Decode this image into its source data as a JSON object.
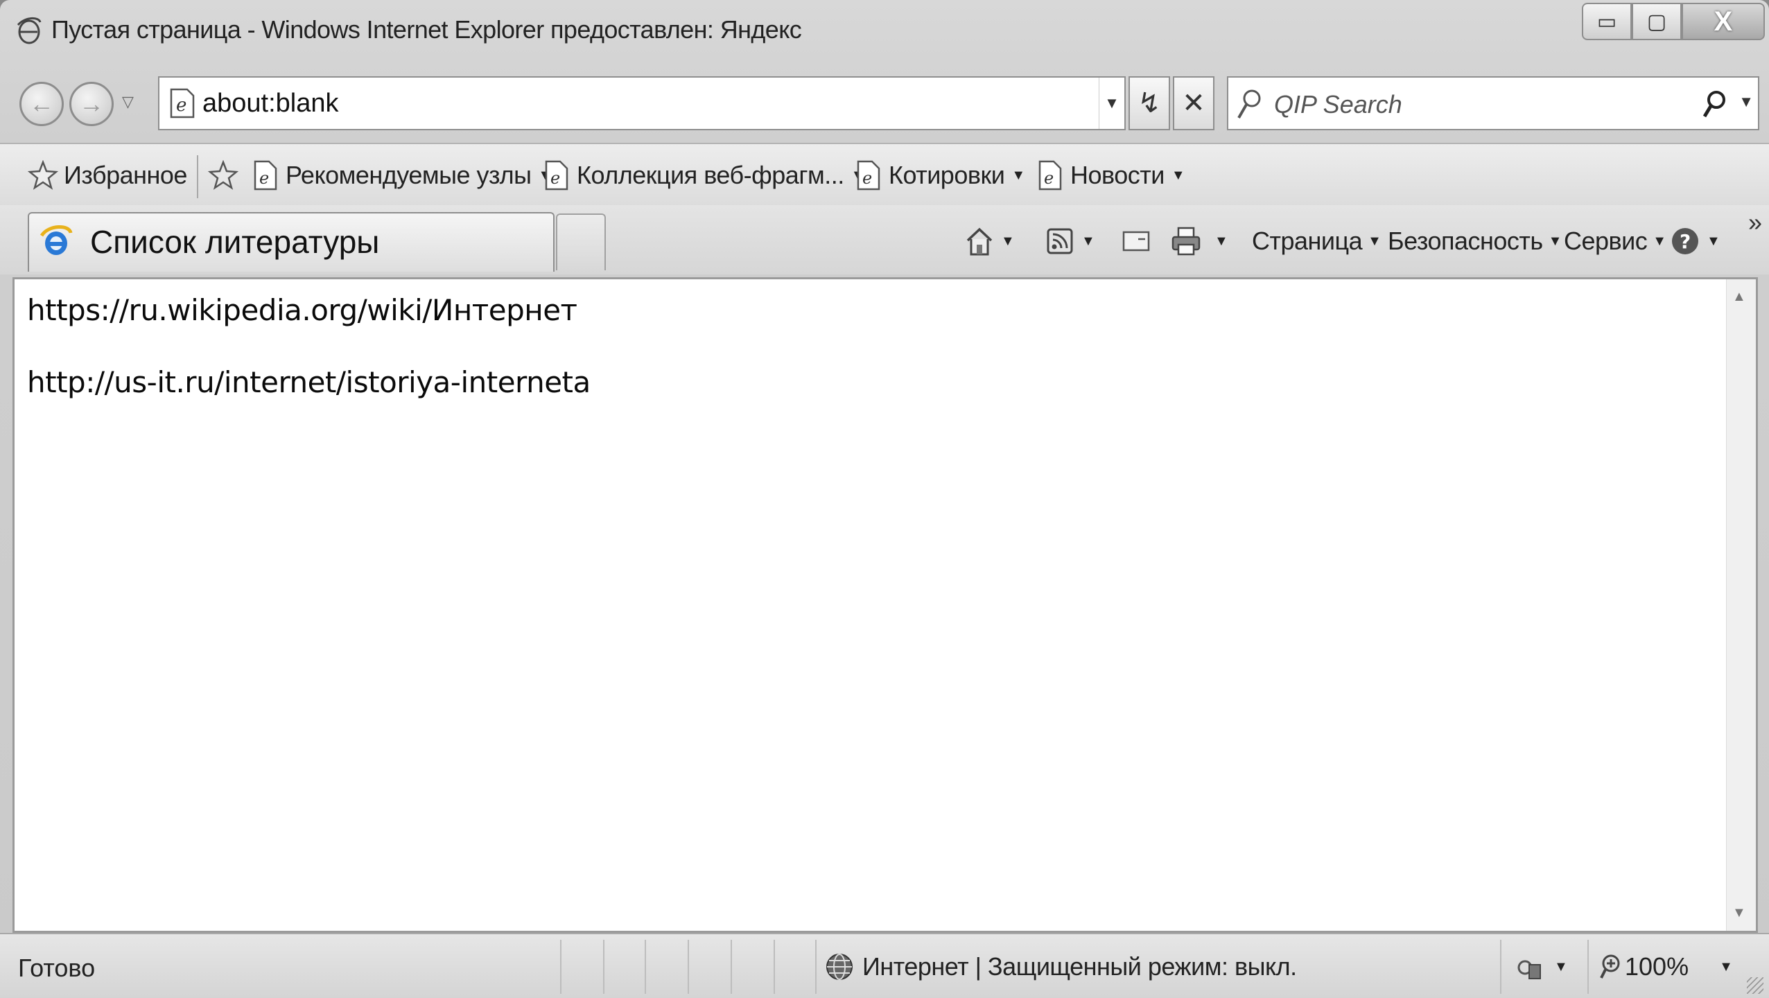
{
  "window": {
    "title": "Пустая страница - Windows Internet Explorer предоставлен: Яндекс",
    "controls": {
      "minimize": "▭",
      "maximize": "▢",
      "close": "X"
    }
  },
  "navigation": {
    "back_icon": "back-arrow-icon",
    "forward_icon": "forward-arrow-icon",
    "address": "about:blank",
    "refresh_symbol": "↯",
    "stop_symbol": "✕",
    "search_placeholder": "QIP Search"
  },
  "favorites_bar": {
    "favorites_label": "Избранное",
    "items": [
      {
        "label": "Рекомендуемые узлы"
      },
      {
        "label": "Коллекция веб-фрагм..."
      },
      {
        "label": "Котировки"
      },
      {
        "label": "Новости"
      }
    ]
  },
  "tabs": {
    "active_tab_label": "Список литературы"
  },
  "command_bar": {
    "page_label": "Страница",
    "safety_label": "Безопасность",
    "tools_label": "Сервис",
    "more_symbol": "»"
  },
  "content": {
    "lines": [
      "https://ru.wikipedia.org/wiki/Интернет",
      "http://us-it.ru/internet/istoriya-interneta"
    ]
  },
  "status_bar": {
    "status_text": "Готово",
    "zone_text": "Интернет | Защищенный режим: выкл.",
    "zoom": "100%"
  },
  "colors": {
    "chrome": "#d6d6d6",
    "content_bg": "#ffffff"
  }
}
